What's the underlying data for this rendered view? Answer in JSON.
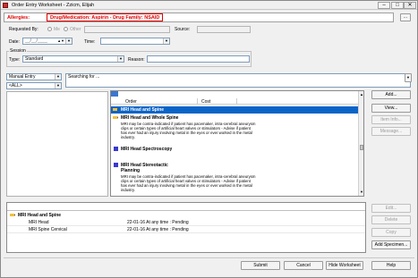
{
  "window": {
    "title": "Order Entry Worksheet - Zzicm, Elijah",
    "min": "–",
    "max": "□",
    "close": "✕"
  },
  "allergy": {
    "label": "Allergies:",
    "value": "Drug/Medication: Aspirin - Drug Family: NSAID",
    "more": "..."
  },
  "requested_by": {
    "label": "Requested By:",
    "opt_me": "Me",
    "opt_other": "Other",
    "source_label": "Source:"
  },
  "date": {
    "label": "Date:",
    "value": "__/__/____",
    "time_label": "Time:"
  },
  "session": {
    "title": "Session",
    "type_label": "Type:",
    "type_value": "Standard",
    "reason_label": "Reason:"
  },
  "left_filters": {
    "entry_mode": "Manual Entry",
    "scope": "<ALL>"
  },
  "search": {
    "label": "Searching for ..."
  },
  "results": {
    "col_order": "Order",
    "col_cost": "Cost",
    "items": [
      {
        "name": "MRI Head and Spine",
        "selected": true,
        "desc": ""
      },
      {
        "name": "MRI Head and Whole Spine",
        "selected": false,
        "desc": "MRI may be contra-indicated if patient has pacemaker, intra-cerebral aneurysm clips or certain types of artificial heart valves or stimulators - Advise if patient has ever had an injury involving metal in the eyes or ever worked in the metal industry."
      },
      {
        "name": "MRI Head Spectroscopy",
        "selected": false,
        "desc": ""
      },
      {
        "name": "MRI Head Stereotactic Planning",
        "selected": false,
        "desc": "MRI may be contra-indicated if patient has pacemaker, intra-cerebral aneurysm clips or certain types of artificial heart valves or stimulators - Advise if patient has ever had an injury involving metal in the eyes or ever worked in the metal industry."
      }
    ]
  },
  "side_buttons": {
    "add": "Add...",
    "view": "View...",
    "item_info": "Item Info...",
    "message": "Message..."
  },
  "worksheet": {
    "group": "MRI Head and Spine",
    "rows": [
      {
        "name": "MRI Head",
        "detail": "22-01-16 At any time : Pending"
      },
      {
        "name": "MRI Spine Cervical",
        "detail": "22-01-16 At any time : Pending"
      }
    ]
  },
  "worksheet_buttons": {
    "edit": "Edit...",
    "delete": "Delete",
    "copy": "Copy",
    "add_specimen": "Add Specimen..."
  },
  "footer": {
    "submit": "Submit",
    "cancel": "Cancel",
    "hide": "Hide Worksheet",
    "help": "Help"
  }
}
